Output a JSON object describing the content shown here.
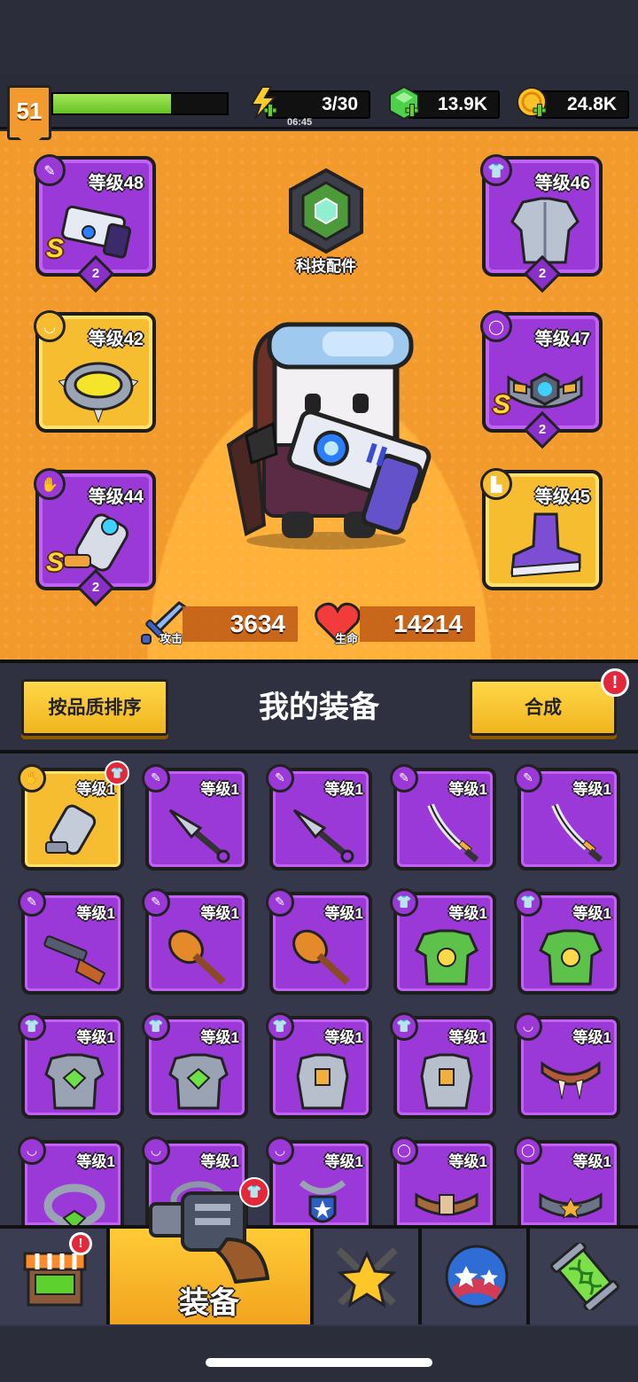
{
  "player": {
    "level": "51",
    "xp_fraction": 0.68
  },
  "resources": {
    "energy": {
      "value": "3/30",
      "timer": "06:45",
      "icon": "lightning-icon"
    },
    "gems": {
      "value": "13.9K",
      "icon": "green-gem-icon"
    },
    "coins": {
      "value": "24.8K",
      "icon": "gold-coin-icon"
    }
  },
  "hero": {
    "tech_label": "科技配件",
    "attack": {
      "caption": "攻击",
      "value": "3634"
    },
    "health": {
      "caption": "生命",
      "value": "14214"
    },
    "slots": {
      "weapon": {
        "label": "等级48",
        "rank": "S",
        "stars": "2",
        "type_icon": "weapon-type-icon",
        "art": "blaster-gun"
      },
      "armor": {
        "label": "等级46",
        "stars": "2",
        "type_icon": "armor-type-icon",
        "art": "steel-armor"
      },
      "necklace": {
        "label": "等级42",
        "type_icon": "necklace-type-icon",
        "art": "spiked-collar"
      },
      "belt": {
        "label": "等级47",
        "rank": "S",
        "stars": "2",
        "type_icon": "belt-type-icon",
        "art": "hex-belt"
      },
      "gloves": {
        "label": "等级44",
        "rank": "S",
        "stars": "2",
        "type_icon": "glove-type-icon",
        "art": "power-gauntlet"
      },
      "boots": {
        "label": "等级45",
        "type_icon": "boot-type-icon",
        "art": "purple-sneaker"
      }
    }
  },
  "equipment": {
    "sort_button": "按品质排序",
    "title": "我的装备",
    "merge_button": "合成",
    "merge_alert": "!",
    "items": [
      {
        "label": "等级1",
        "quality": "gold",
        "type": "glove",
        "art": "gauntlet",
        "new": true
      },
      {
        "label": "等级1",
        "quality": "purple",
        "type": "weapon",
        "art": "kunai"
      },
      {
        "label": "等级1",
        "quality": "purple",
        "type": "weapon",
        "art": "kunai"
      },
      {
        "label": "等级1",
        "quality": "purple",
        "type": "weapon",
        "art": "katana"
      },
      {
        "label": "等级1",
        "quality": "purple",
        "type": "weapon",
        "art": "katana"
      },
      {
        "label": "等级1",
        "quality": "purple",
        "type": "weapon",
        "art": "shotgun"
      },
      {
        "label": "等级1",
        "quality": "purple",
        "type": "weapon",
        "art": "club"
      },
      {
        "label": "等级1",
        "quality": "purple",
        "type": "weapon",
        "art": "club"
      },
      {
        "label": "等级1",
        "quality": "purple",
        "type": "armor",
        "art": "green-armor"
      },
      {
        "label": "等级1",
        "quality": "purple",
        "type": "armor",
        "art": "green-armor"
      },
      {
        "label": "等级1",
        "quality": "purple",
        "type": "armor",
        "art": "gem-armor"
      },
      {
        "label": "等级1",
        "quality": "purple",
        "type": "armor",
        "art": "gem-armor"
      },
      {
        "label": "等级1",
        "quality": "purple",
        "type": "armor",
        "art": "plate-armor"
      },
      {
        "label": "等级1",
        "quality": "purple",
        "type": "armor",
        "art": "plate-armor"
      },
      {
        "label": "等级1",
        "quality": "purple",
        "type": "necklace",
        "art": "fang-necklace"
      },
      {
        "label": "等级1",
        "quality": "purple",
        "type": "necklace",
        "art": "gem-ring"
      },
      {
        "label": "等级1",
        "quality": "purple",
        "type": "necklace",
        "art": "chain"
      },
      {
        "label": "等级1",
        "quality": "purple",
        "type": "necklace",
        "art": "shield-pendant"
      },
      {
        "label": "等级1",
        "quality": "purple",
        "type": "belt",
        "art": "rope-belt"
      },
      {
        "label": "等级1",
        "quality": "purple",
        "type": "belt",
        "art": "star-belt"
      }
    ]
  },
  "nav": {
    "tabs": [
      {
        "name": "shop",
        "icon": "shop-icon",
        "alert": "!"
      },
      {
        "name": "equipment",
        "label": "装备",
        "icon": "revolver-icon",
        "active": true
      },
      {
        "name": "talents",
        "icon": "star-swords-icon"
      },
      {
        "name": "skills",
        "icon": "stars-ball-icon"
      },
      {
        "name": "evolution",
        "icon": "dna-capsule-icon"
      }
    ]
  },
  "colors": {
    "accent_orange": "#f39a2c",
    "purple_quality": "#9a38d8",
    "gold_quality": "#f6bd30",
    "alert_red": "#e3283a"
  }
}
